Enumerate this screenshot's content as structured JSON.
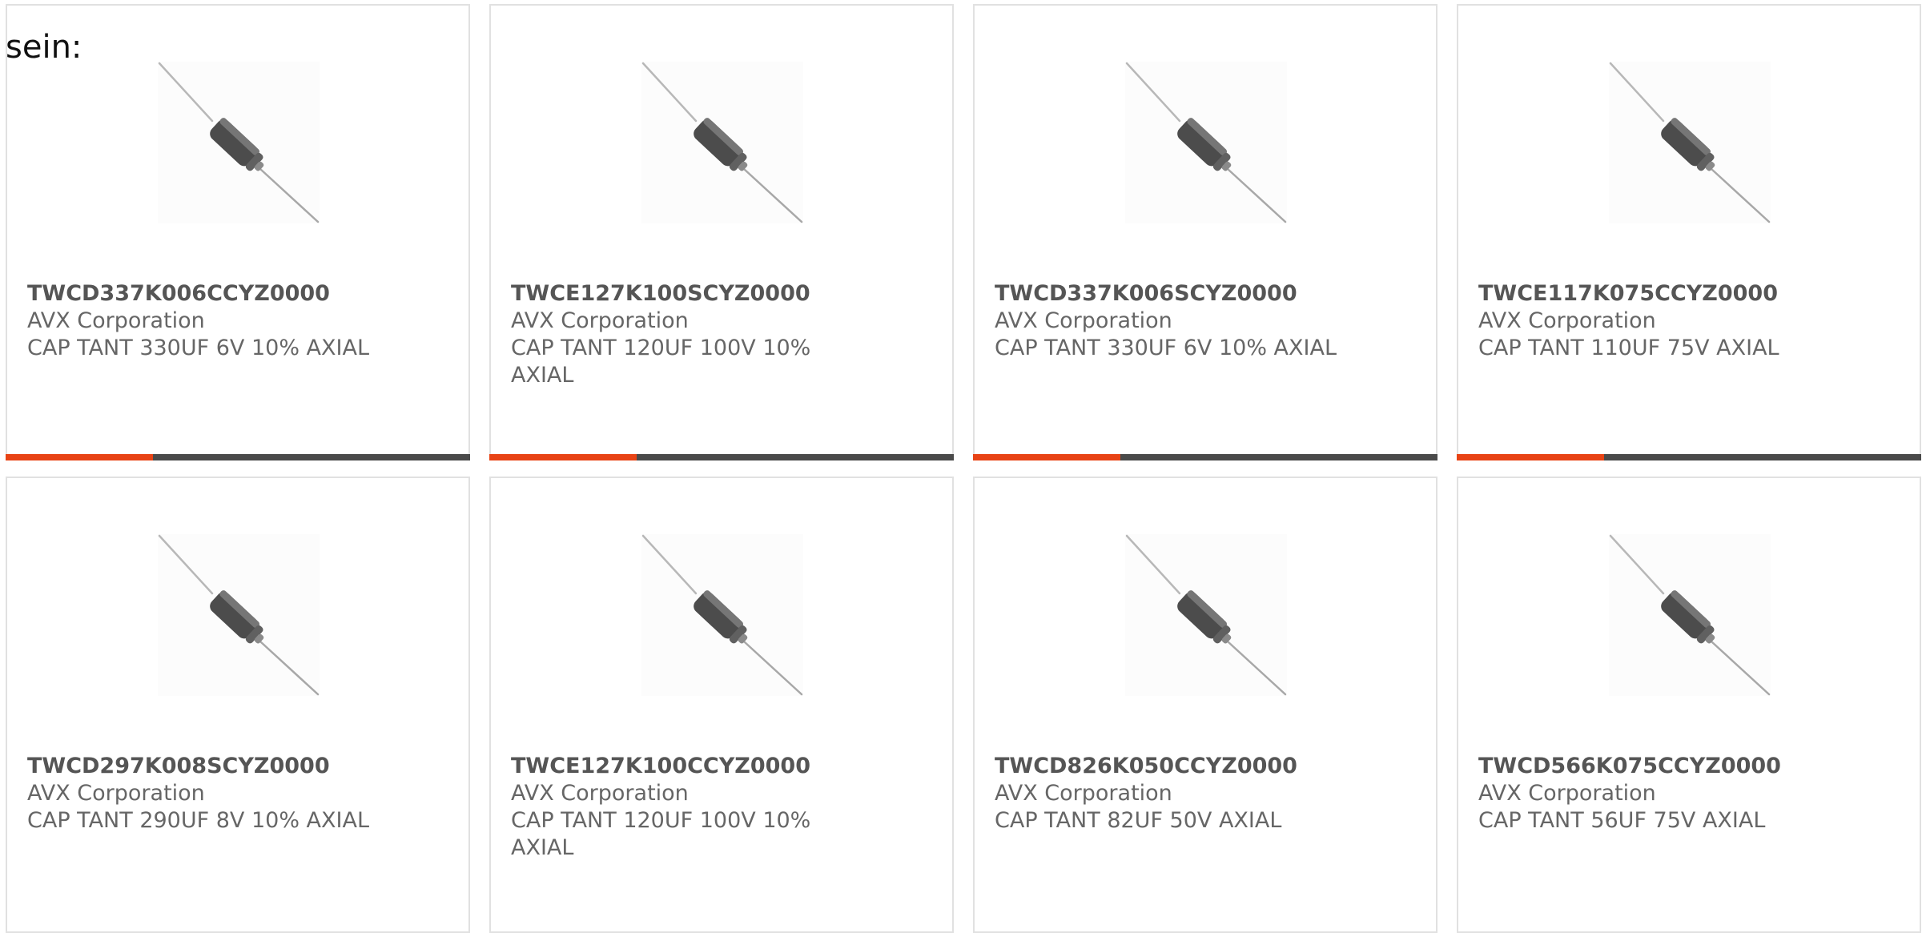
{
  "intro_text": "sein:",
  "colors": {
    "accent": "#e84315",
    "bar_dark": "#4a4a4a",
    "border": "#e1e1e1"
  },
  "products": [
    {
      "part": "TWCD337K006CCYZ0000",
      "maker": "AVX Corporation",
      "desc": "CAP TANT 330UF 6V 10% AXIAL",
      "image": "axial-tantalum-capacitor",
      "accent_bar": true
    },
    {
      "part": "TWCE127K100SCYZ0000",
      "maker": "AVX Corporation",
      "desc": "CAP TANT 120UF 100V 10% AXIAL",
      "image": "axial-tantalum-capacitor",
      "accent_bar": true
    },
    {
      "part": "TWCD337K006SCYZ0000",
      "maker": "AVX Corporation",
      "desc": "CAP TANT 330UF 6V 10% AXIAL",
      "image": "axial-tantalum-capacitor",
      "accent_bar": true
    },
    {
      "part": "TWCE117K075CCYZ0000",
      "maker": "AVX Corporation",
      "desc": "CAP TANT 110UF 75V AXIAL",
      "image": "axial-tantalum-capacitor",
      "accent_bar": true
    },
    {
      "part": "TWCD297K008SCYZ0000",
      "maker": "AVX Corporation",
      "desc": "CAP TANT 290UF 8V 10% AXIAL",
      "image": "axial-tantalum-capacitor",
      "accent_bar": false
    },
    {
      "part": "TWCE127K100CCYZ0000",
      "maker": "AVX Corporation",
      "desc": "CAP TANT 120UF 100V 10% AXIAL",
      "image": "axial-tantalum-capacitor",
      "accent_bar": false
    },
    {
      "part": "TWCD826K050CCYZ0000",
      "maker": "AVX Corporation",
      "desc": "CAP TANT 82UF 50V AXIAL",
      "image": "axial-tantalum-capacitor",
      "accent_bar": false
    },
    {
      "part": "TWCD566K075CCYZ0000",
      "maker": "AVX Corporation",
      "desc": "CAP TANT 56UF 75V AXIAL",
      "image": "axial-tantalum-capacitor",
      "accent_bar": false
    }
  ]
}
